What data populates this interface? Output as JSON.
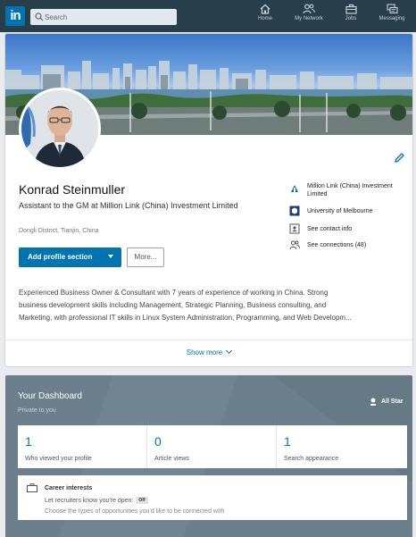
{
  "nav": {
    "logo": "in",
    "search_placeholder": "Search",
    "items": [
      {
        "label": "Home",
        "icon": "home-icon"
      },
      {
        "label": "My Network",
        "icon": "network-icon"
      },
      {
        "label": "Jobs",
        "icon": "jobs-icon"
      },
      {
        "label": "Messaging",
        "icon": "messaging-icon"
      }
    ],
    "colors": {
      "bar": "#283e4a",
      "logo": "#0073b1"
    }
  },
  "profile": {
    "name": "Konrad Steinmuller",
    "headline": "Assistant to the GM at Million Link (China) Investment Limited",
    "location": "Dongli District, Tianjin, China",
    "add_section_label": "Add profile section",
    "more_label": "More...",
    "info": [
      {
        "text": "Million Link (China) Investment Limited",
        "icon": "company-icon"
      },
      {
        "text": "University of Melbourne",
        "icon": "school-icon"
      },
      {
        "text": "See contact info",
        "icon": "contact-card-icon"
      },
      {
        "text": "See connections (48)",
        "icon": "connections-icon"
      }
    ],
    "summary": [
      "Experienced Business Owner & Consultant with 7 years of experience of working in China. Strong",
      "business development skills including Management, Strategic Planning, Business consulting, and",
      "Marketing, with professional IT skills in Linux System Administration, Programming, and Web Developm..."
    ],
    "show_more_label": "Show more",
    "accent_color": "#0073b1"
  },
  "dashboard": {
    "title": "Your Dashboard",
    "subtitle": "Private to you",
    "star_label": "All Star",
    "stats": [
      {
        "value": "1",
        "label": "Who viewed your profile"
      },
      {
        "value": "0",
        "label": "Article views"
      },
      {
        "value": "1",
        "label": "Search appearance"
      }
    ],
    "career": {
      "title": "Career interests",
      "line1": "Let recruiters know you're open:",
      "badge": "Off",
      "line2": "Choose the types of opportunities you'd like to be connected with"
    }
  }
}
